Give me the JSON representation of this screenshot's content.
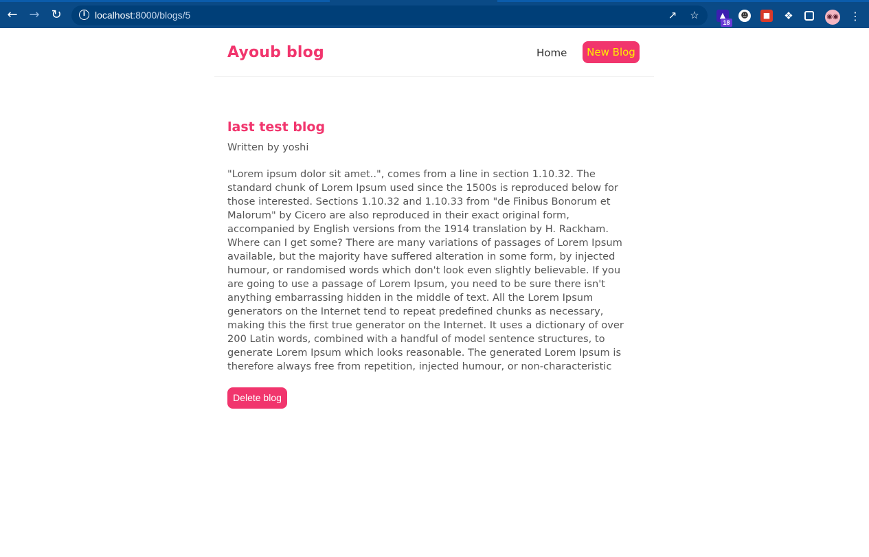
{
  "browser": {
    "back_icon": "arrow-left-icon",
    "forward_icon": "arrow-right-icon",
    "reload_icon": "reload-icon",
    "info_icon": "info-icon",
    "url_host": "localhost",
    "url_path": ":8000/blogs/5",
    "share_icon": "share-icon",
    "star_icon": "star-icon",
    "extension_badge": "18",
    "extensions_icon": "puzzle-icon",
    "sidepanel_icon": "side-panel-icon",
    "menu_icon": "kebab-menu-icon"
  },
  "navbar": {
    "brand": "Ayoub blog",
    "home_label": "Home",
    "new_blog_label": "New Blog"
  },
  "blog": {
    "title": "last test blog",
    "author_line": "Written by yoshi",
    "body": "\"Lorem ipsum dolor sit amet..\", comes from a line in section 1.10.32. The standard chunk of Lorem Ipsum used since the 1500s is reproduced below for those interested. Sections 1.10.32 and 1.10.33 from \"de Finibus Bonorum et Malorum\" by Cicero are also reproduced in their exact original form, accompanied by English versions from the 1914 translation by H. Rackham. Where can I get some? There are many variations of passages of Lorem Ipsum available, but the majority have suffered alteration in some form, by injected humour, or randomised words which don't look even slightly believable. If you are going to use a passage of Lorem Ipsum, you need to be sure there isn't anything embarrassing hidden in the middle of text. All the Lorem Ipsum generators on the Internet tend to repeat predefined chunks as necessary, making this the first true generator on the Internet. It uses a dictionary of over 200 Latin words, combined with a handful of model sentence structures, to generate Lorem Ipsum which looks reasonable. The generated Lorem Ipsum is therefore always free from repetition, injected humour, or non-characteristic",
    "delete_label": "Delete blog"
  },
  "colors": {
    "accent": "#f1356d",
    "new_blog_text": "#ffee00",
    "chrome_bar": "#0a4a86"
  }
}
